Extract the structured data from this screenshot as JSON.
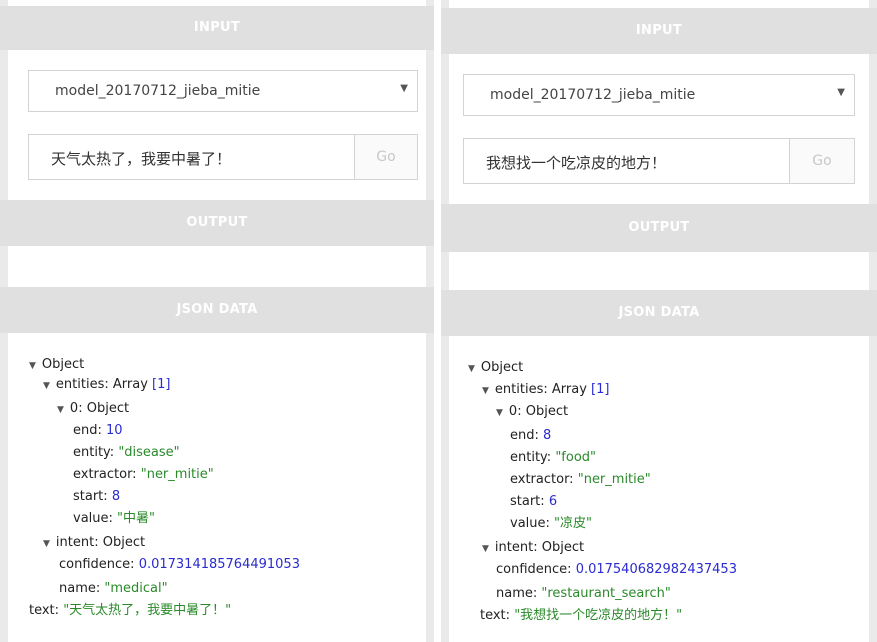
{
  "sections": {
    "input": "INPUT",
    "output": "OUTPUT",
    "json": "JSON DATA"
  },
  "controls": {
    "go_label": "Go",
    "caret": "▼",
    "tree_toggle": "▼"
  },
  "panels": [
    {
      "model": "model_20170712_jieba_mitie",
      "query": "天气太热了，我要中暑了！",
      "json": {
        "root_label": "Object",
        "entities_key": "entities:",
        "entities_type": "Array",
        "entities_count": "[1]",
        "item_key": "0:",
        "item_type": "Object",
        "end_key": "end:",
        "end_val": "10",
        "entity_key": "entity:",
        "entity_val": "\"disease\"",
        "extractor_key": "extractor:",
        "extractor_val": "\"ner_mitie\"",
        "start_key": "start:",
        "start_val": "8",
        "value_key": "value:",
        "value_val": "\"中暑\"",
        "intent_key": "intent:",
        "intent_type": "Object",
        "confidence_key": "confidence:",
        "confidence_val": "0.017314185764491053",
        "name_key": "name:",
        "name_val": "\"medical\"",
        "text_key": "text:",
        "text_val": "\"天气太热了，我要中暑了！\""
      }
    },
    {
      "model": "model_20170712_jieba_mitie",
      "query": "我想找一个吃凉皮的地方！",
      "json": {
        "root_label": "Object",
        "entities_key": "entities:",
        "entities_type": "Array",
        "entities_count": "[1]",
        "item_key": "0:",
        "item_type": "Object",
        "end_key": "end:",
        "end_val": "8",
        "entity_key": "entity:",
        "entity_val": "\"food\"",
        "extractor_key": "extractor:",
        "extractor_val": "\"ner_mitie\"",
        "start_key": "start:",
        "start_val": "6",
        "value_key": "value:",
        "value_val": "\"凉皮\"",
        "intent_key": "intent:",
        "intent_type": "Object",
        "confidence_key": "confidence:",
        "confidence_val": "0.017540682982437453",
        "name_key": "name:",
        "name_val": "\"restaurant_search\"",
        "text_key": "text:",
        "text_val": "\"我想找一个吃凉皮的地方！\""
      }
    }
  ]
}
